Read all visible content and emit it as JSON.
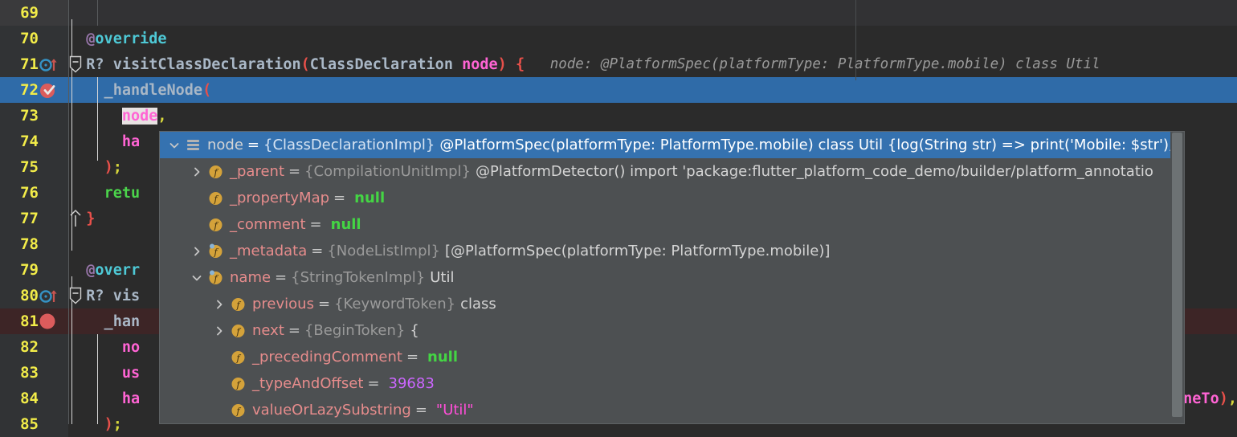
{
  "editor": {
    "background": "#2b2b2b",
    "gutter_background": "#313335",
    "selection_color": "#2f6ba8",
    "breakpoint_line_color": "#3d2526",
    "line_number_color": "#f2ec49",
    "lines": [
      {
        "no": "69",
        "tokens": [],
        "state": "current",
        "icons": []
      },
      {
        "no": "70",
        "tokens": [
          {
            "t": "  ",
            "c": "ident"
          },
          {
            "t": "@",
            "c": "annoat"
          },
          {
            "t": "override",
            "c": "cyan"
          }
        ],
        "state": "normal",
        "icons": []
      },
      {
        "no": "71",
        "tokens": [
          {
            "t": "  ",
            "c": "ident"
          },
          {
            "t": "R?",
            "c": "type"
          },
          {
            "t": " visitClassDeclaration",
            "c": "ident"
          },
          {
            "t": "(",
            "c": "paren"
          },
          {
            "t": "ClassDeclaration ",
            "c": "ident"
          },
          {
            "t": "node",
            "c": "param"
          },
          {
            "t": ")",
            "c": "paren"
          },
          {
            "t": " ",
            "c": "ident"
          },
          {
            "t": "{",
            "c": "brace"
          }
        ],
        "hint": "node: @PlatformSpec(platformType: PlatformType.mobile) class Util",
        "state": "normal",
        "icons": [
          "override",
          "fold"
        ]
      },
      {
        "no": "72",
        "tokens": [
          {
            "t": "    _handleNode",
            "c": "ident"
          },
          {
            "t": "(",
            "c": "paren"
          }
        ],
        "state": "selected",
        "icons": [
          "breakpoint-verified"
        ]
      },
      {
        "no": "73",
        "tokens": [
          {
            "t": "      ",
            "c": "ident"
          },
          {
            "t": "node",
            "c": "paramhl"
          },
          {
            "t": ",",
            "c": "semi"
          }
        ],
        "state": "normal",
        "icons": []
      },
      {
        "no": "74",
        "tokens": [
          {
            "t": "      ",
            "c": "ident"
          },
          {
            "t": "ha",
            "c": "param"
          }
        ],
        "state": "normal",
        "icons": []
      },
      {
        "no": "75",
        "tokens": [
          {
            "t": "    ",
            "c": "ident"
          },
          {
            "t": ")",
            "c": "paren"
          },
          {
            "t": ";",
            "c": "semi"
          }
        ],
        "state": "normal",
        "icons": []
      },
      {
        "no": "76",
        "tokens": [
          {
            "t": "    ",
            "c": "ident"
          },
          {
            "t": "retu",
            "c": "ret"
          }
        ],
        "state": "normal",
        "icons": []
      },
      {
        "no": "77",
        "tokens": [
          {
            "t": "  ",
            "c": "ident"
          },
          {
            "t": "}",
            "c": "brace"
          }
        ],
        "state": "normal",
        "icons": [
          "fold-end"
        ]
      },
      {
        "no": "78",
        "tokens": [],
        "state": "normal",
        "icons": []
      },
      {
        "no": "79",
        "tokens": [
          {
            "t": "  ",
            "c": "ident"
          },
          {
            "t": "@",
            "c": "annoat"
          },
          {
            "t": "overr",
            "c": "cyan"
          }
        ],
        "state": "normal",
        "icons": []
      },
      {
        "no": "80",
        "tokens": [
          {
            "t": "  ",
            "c": "ident"
          },
          {
            "t": "R?",
            "c": "type"
          },
          {
            "t": " vis",
            "c": "ident"
          }
        ],
        "state": "normal",
        "icons": [
          "override",
          "fold"
        ]
      },
      {
        "no": "81",
        "tokens": [
          {
            "t": "    _han",
            "c": "ident"
          }
        ],
        "state": "breakpoint",
        "icons": [
          "breakpoint"
        ]
      },
      {
        "no": "82",
        "tokens": [
          {
            "t": "      ",
            "c": "ident"
          },
          {
            "t": "no",
            "c": "param"
          }
        ],
        "state": "normal",
        "icons": []
      },
      {
        "no": "83",
        "tokens": [
          {
            "t": "      ",
            "c": "ident"
          },
          {
            "t": "us",
            "c": "param"
          }
        ],
        "state": "normal",
        "icons": []
      },
      {
        "no": "84",
        "tokens": [
          {
            "t": "      ",
            "c": "ident"
          },
          {
            "t": "ha",
            "c": "param"
          }
        ],
        "tail": [
          {
            "t": "neTo",
            "c": "param"
          },
          {
            "t": ")",
            "c": "paren"
          },
          {
            "t": ",",
            "c": "semi"
          }
        ],
        "state": "normal",
        "icons": []
      },
      {
        "no": "85",
        "tokens": [
          {
            "t": "    ",
            "c": "ident"
          },
          {
            "t": ")",
            "c": "paren"
          },
          {
            "t": ";",
            "c": "semi"
          }
        ],
        "state": "normal",
        "icons": []
      }
    ]
  },
  "popup": {
    "title": "debugger-value-tree",
    "selected_row_color": "#3572b0",
    "background": "#4d5052",
    "rows": [
      {
        "indent": 0,
        "twisty": "expanded",
        "icon": "node-list-icon",
        "name": "node",
        "type": "{ClassDeclarationImpl}",
        "value": "@PlatformSpec(platformType: PlatformType.mobile) class Util {log(String str) => print('Mobile: $str');}",
        "value_kind": "plain",
        "selected": true
      },
      {
        "indent": 1,
        "twisty": "collapsed",
        "icon": "field-icon",
        "name": "_parent",
        "type": "{CompilationUnitImpl}",
        "value": "@PlatformDetector() import 'package:flutter_platform_code_demo/builder/platform_annotatio",
        "value_kind": "plain",
        "selected": false
      },
      {
        "indent": 1,
        "twisty": "none",
        "icon": "field-icon",
        "name": "_propertyMap",
        "type": "",
        "value": "null",
        "value_kind": "null",
        "selected": false
      },
      {
        "indent": 1,
        "twisty": "none",
        "icon": "field-icon",
        "name": "_comment",
        "type": "",
        "value": "null",
        "value_kind": "null",
        "selected": false
      },
      {
        "indent": 1,
        "twisty": "collapsed",
        "icon": "field-icon-watched",
        "name": "_metadata",
        "type": "{NodeListImpl}",
        "value": "[@PlatformSpec(platformType: PlatformType.mobile)]",
        "value_kind": "plain",
        "selected": false
      },
      {
        "indent": 1,
        "twisty": "expanded",
        "icon": "field-icon-watched",
        "name": "name",
        "type": "{StringTokenImpl}",
        "value": "Util",
        "value_kind": "plain",
        "selected": false
      },
      {
        "indent": 2,
        "twisty": "collapsed",
        "icon": "field-icon",
        "name": "previous",
        "type": "{KeywordToken}",
        "value": "class",
        "value_kind": "plain",
        "selected": false
      },
      {
        "indent": 2,
        "twisty": "collapsed",
        "icon": "field-icon",
        "name": "next",
        "type": "{BeginToken}",
        "value": "{",
        "value_kind": "plain",
        "selected": false
      },
      {
        "indent": 2,
        "twisty": "none",
        "icon": "field-icon",
        "name": "_precedingComment",
        "type": "",
        "value": "null",
        "value_kind": "null",
        "selected": false
      },
      {
        "indent": 2,
        "twisty": "none",
        "icon": "field-icon",
        "name": "_typeAndOffset",
        "type": "",
        "value": "39683",
        "value_kind": "number",
        "selected": false
      },
      {
        "indent": 2,
        "twisty": "none",
        "icon": "field-icon",
        "name": "valueOrLazySubstring",
        "type": "",
        "value": "\"Util\"",
        "value_kind": "string",
        "selected": false
      }
    ]
  }
}
